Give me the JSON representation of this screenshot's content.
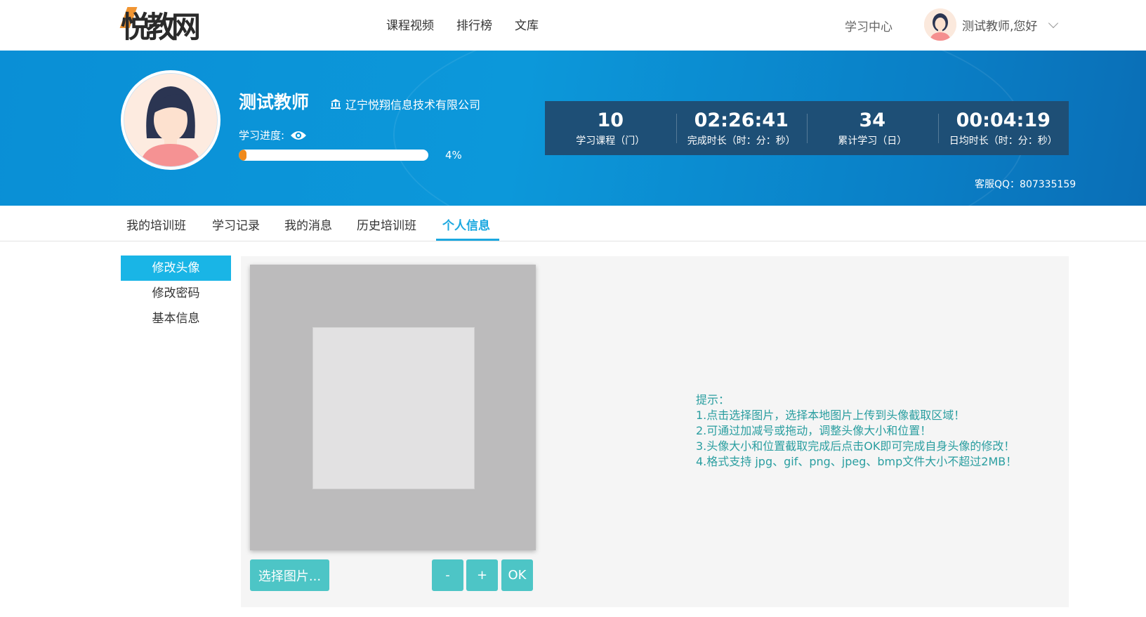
{
  "header": {
    "logo_text": "悦教网",
    "nav": [
      "课程视频",
      "排行榜",
      "文库"
    ],
    "study_center": "学习中心",
    "greeting": "测试教师,您好"
  },
  "profile": {
    "name": "测试教师",
    "org": "辽宁悦翔信息技术有限公司",
    "progress_label": "学习进度:",
    "progress_percent": 4,
    "progress_text": "4%",
    "stats": [
      {
        "value": "10",
        "label": "学习课程（门）"
      },
      {
        "value": "02:26:41",
        "label": "完成时长（时：分：秒）"
      },
      {
        "value": "34",
        "label": "累计学习（日）"
      },
      {
        "value": "00:04:19",
        "label": "日均时长（时：分：秒）"
      }
    ],
    "service": "客服QQ：807335159"
  },
  "tabs": [
    "我的培训班",
    "学习记录",
    "我的消息",
    "历史培训班",
    "个人信息"
  ],
  "active_tab": "个人信息",
  "side_menu": [
    "修改头像",
    "修改密码",
    "基本信息"
  ],
  "editor": {
    "choose_label": "选择图片...",
    "minus_label": "-",
    "plus_label": "+",
    "ok_label": "OK"
  },
  "tips": [
    "提示：",
    "1.点击选择图片，选择本地图片上传到头像截取区域！",
    "2.可通过加减号或拖动，调整头像大小和位置！",
    "3.头像大小和位置截取完成后点击OK即可完成自身头像的修改！",
    "4.格式支持 jpg、gif、png、jpeg、bmp文件大小不超过2MB！"
  ],
  "colors": {
    "accent": "#19b5e6",
    "banner": "#0c98da",
    "stats_bg": "#1e4f76",
    "progress": "#f08a1c",
    "button": "#4dc5c6",
    "tip_text": "#2a9ea0"
  }
}
